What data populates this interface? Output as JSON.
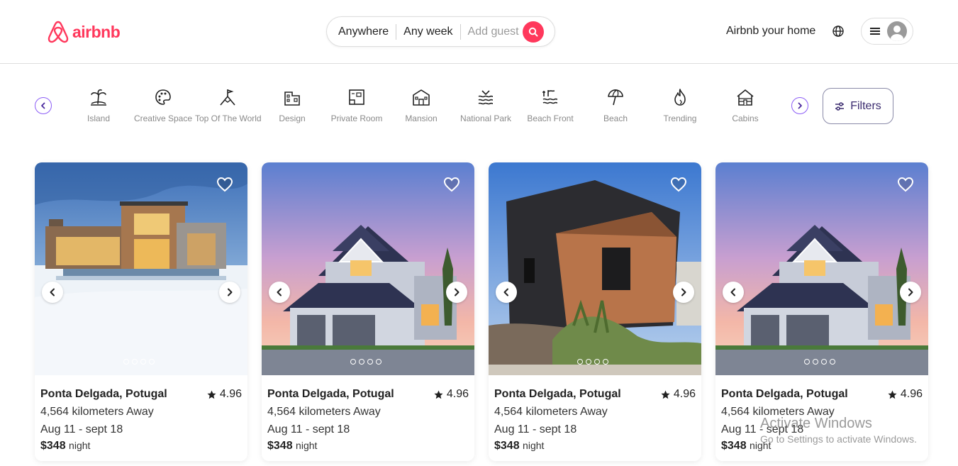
{
  "header": {
    "brand": "airbnb",
    "brand_color": "#ff385c",
    "search": {
      "location": "Anywhere",
      "dates": "Any week",
      "guests_placeholder": "Add guest"
    },
    "host_link": "Airbnb your home"
  },
  "categories": {
    "items": [
      {
        "label": "Island",
        "icon": "palm-island-icon"
      },
      {
        "label": "Creative Space",
        "icon": "palette-icon"
      },
      {
        "label": "Top Of The World",
        "icon": "flag-peak-icon"
      },
      {
        "label": "Design",
        "icon": "building-design-icon"
      },
      {
        "label": "Private Room",
        "icon": "private-room-icon"
      },
      {
        "label": "Mansion",
        "icon": "mansion-icon"
      },
      {
        "label": "National Park",
        "icon": "waves-park-icon"
      },
      {
        "label": "Beach Front",
        "icon": "beach-front-icon"
      },
      {
        "label": "Beach",
        "icon": "umbrella-icon"
      },
      {
        "label": "Trending",
        "icon": "flame-icon"
      },
      {
        "label": "Cabins",
        "icon": "cabin-icon"
      }
    ],
    "filters_label": "Filters",
    "accent_color": "#8b5cf6"
  },
  "listings": [
    {
      "title": "Ponta Delgada, Potugal",
      "rating": "4.96",
      "distance": "4,564 kilometers Away",
      "dates": "Aug 11 - sept 18",
      "price": "$348",
      "price_unit": "night",
      "photo": "modern-villa-snow"
    },
    {
      "title": "Ponta Delgada, Potugal",
      "rating": "4.96",
      "distance": "4,564 kilometers Away",
      "dates": "Aug 11 - sept 18",
      "price": "$348",
      "price_unit": "night",
      "photo": "suburban-house-dusk"
    },
    {
      "title": "Ponta Delgada, Potugal",
      "rating": "4.96",
      "distance": "4,564 kilometers Away",
      "dates": "Aug 11 - sept 18",
      "price": "$348",
      "price_unit": "night",
      "photo": "black-wood-house"
    },
    {
      "title": "Ponta Delgada, Potugal",
      "rating": "4.96",
      "distance": "4,564 kilometers Away",
      "dates": "Aug 11 - sept 18",
      "price": "$348",
      "price_unit": "night",
      "photo": "suburban-house-dusk"
    }
  ],
  "watermark": {
    "title": "Activate Windows",
    "subtitle": "Go to Settings to activate Windows."
  }
}
